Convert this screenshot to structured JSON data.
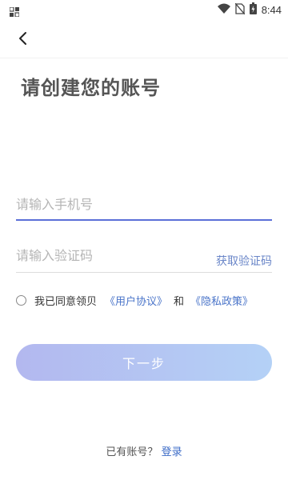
{
  "status_bar": {
    "time": "8:44",
    "icons": [
      "notification-icon",
      "wifi-icon",
      "no-sim-icon",
      "battery-icon"
    ]
  },
  "header": {
    "back_icon": "back-arrow-icon",
    "title": "请创建您的账号"
  },
  "form": {
    "phone_placeholder": "请输入手机号",
    "phone_value": "",
    "code_placeholder": "请输入验证码",
    "code_value": "",
    "get_code_label": "获取验证码"
  },
  "agreement": {
    "checked": false,
    "text": "我已同意领贝",
    "user_agreement": "《用户协议》",
    "and": "和",
    "privacy_policy": "《隐私政策》"
  },
  "next_button": {
    "label": "下一步"
  },
  "footer": {
    "has_account": "已有账号？",
    "login": "登录"
  },
  "colors": {
    "accent": "#5b6fd8",
    "link": "#4a74c9",
    "button_gradient_start": "#b3b8ef",
    "button_gradient_end": "#b4d1f6"
  }
}
